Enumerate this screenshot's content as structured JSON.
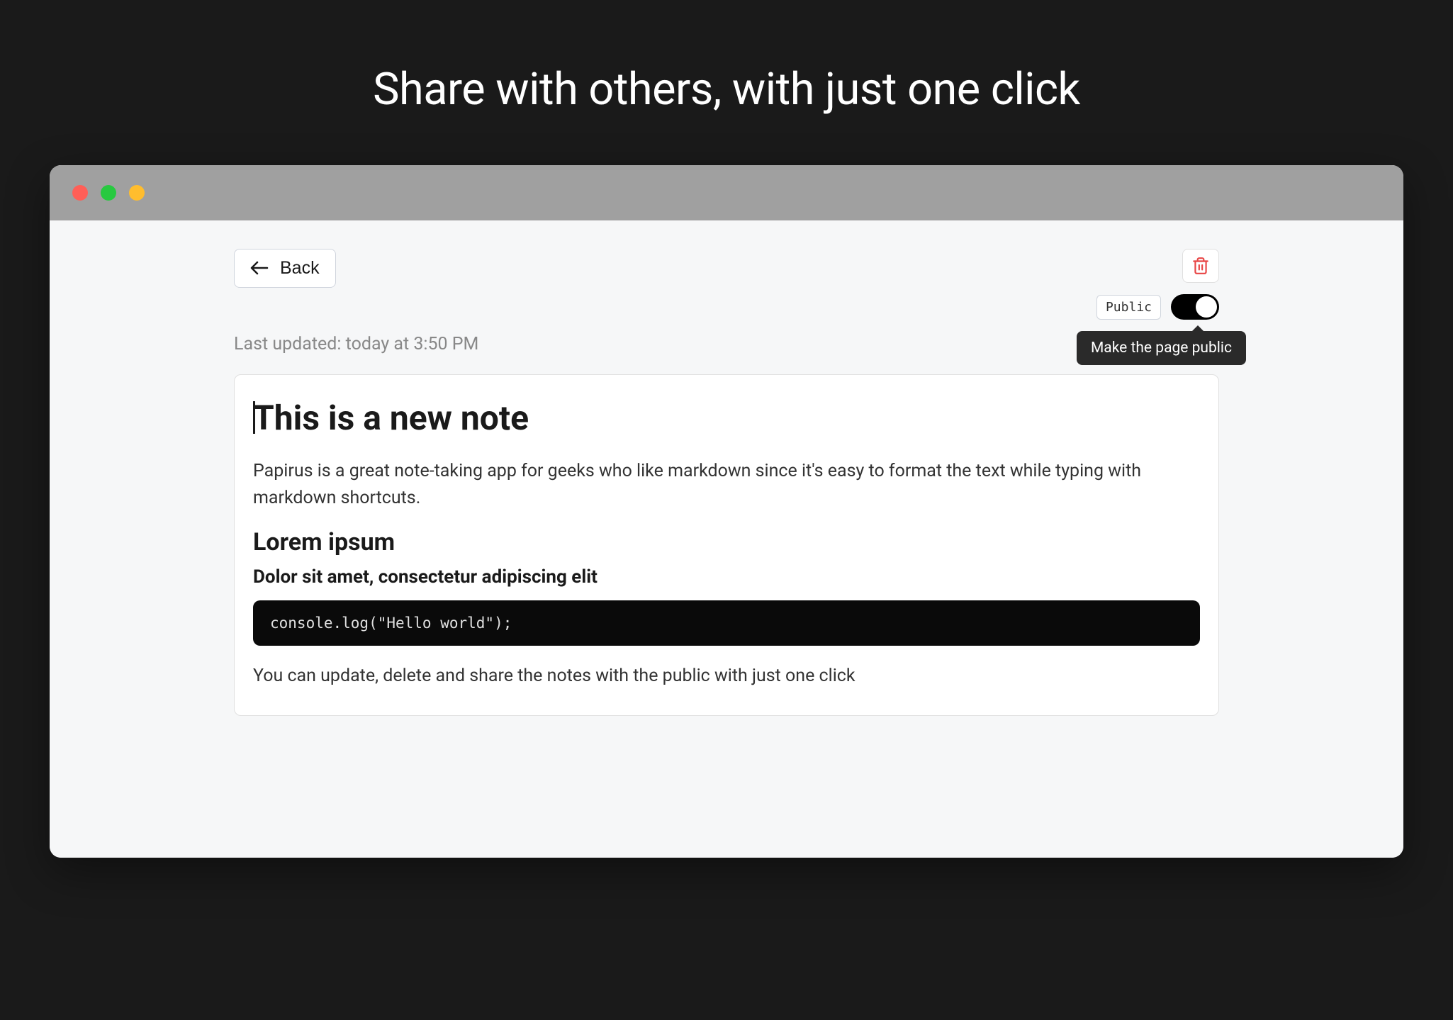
{
  "heading": "Share with others, with just one click",
  "toolbar": {
    "back_label": "Back",
    "public_badge": "Public",
    "tooltip": "Make the page public"
  },
  "meta": {
    "last_updated": "Last updated: today at 3:50 PM"
  },
  "note": {
    "title": "This is a new note",
    "paragraph1": "Papirus is a great note-taking app for geeks who like markdown since it's easy to format the text while typing with markdown shortcuts.",
    "heading2": "Lorem ipsum",
    "heading3": "Dolor sit amet, consectetur adipiscing elit",
    "code": "console.log(\"Hello world\");",
    "paragraph2": "You can update, delete and share the notes with the public with just one click"
  },
  "colors": {
    "danger": "#e84545",
    "background_dark": "#1a1a1a",
    "window_gray": "#a0a0a0"
  }
}
